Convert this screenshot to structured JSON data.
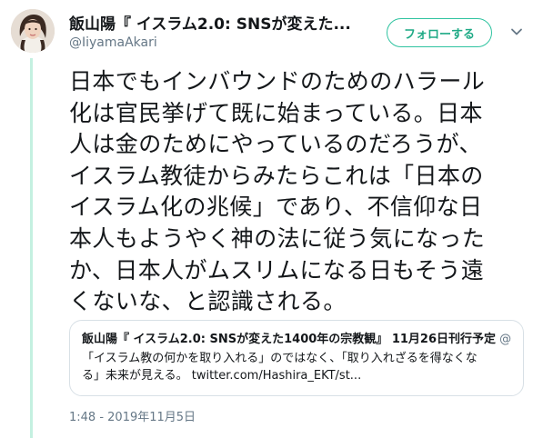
{
  "author": {
    "name": "飯山陽『 イスラム2.0: SNSが変えた...",
    "handle": "@IiyamaAkari"
  },
  "follow_button": {
    "label": "フォローする"
  },
  "tweet": {
    "text": "日本でもインバウンドのためのハラール\n化は官民挙げて既に始まっている。日本\n人は金のためにやっているのだろうが、\nイスラム教徒からみたらこれは「日本の\nイスラム化の兆候」であり、不信仰な日\n本人もようやく神の法に従う気になった\nか、日本人がムスリムになる日もそう遠\nくないな、と認識される。"
  },
  "quote": {
    "name": "飯山陽『 イスラム2.0: SNSが変えた1400年の宗教観』 11月26日刊行予定",
    "handle": "@",
    "text": "「イスラム教の何かを取り入れる」のではなく、「取り入れざるを得なくな\nる」未来が見える。 twitter.com/Hashira_EKT/st..."
  },
  "timestamp": "1:48 - 2019年11月5日",
  "colors": {
    "accent": "#2fc3a0",
    "thread_line": "#c4f0e0",
    "secondary_text": "#657786",
    "border": "#d8e0e6"
  },
  "icons": {
    "avatar": "profile-photo",
    "menu": "chevron-down-icon"
  }
}
